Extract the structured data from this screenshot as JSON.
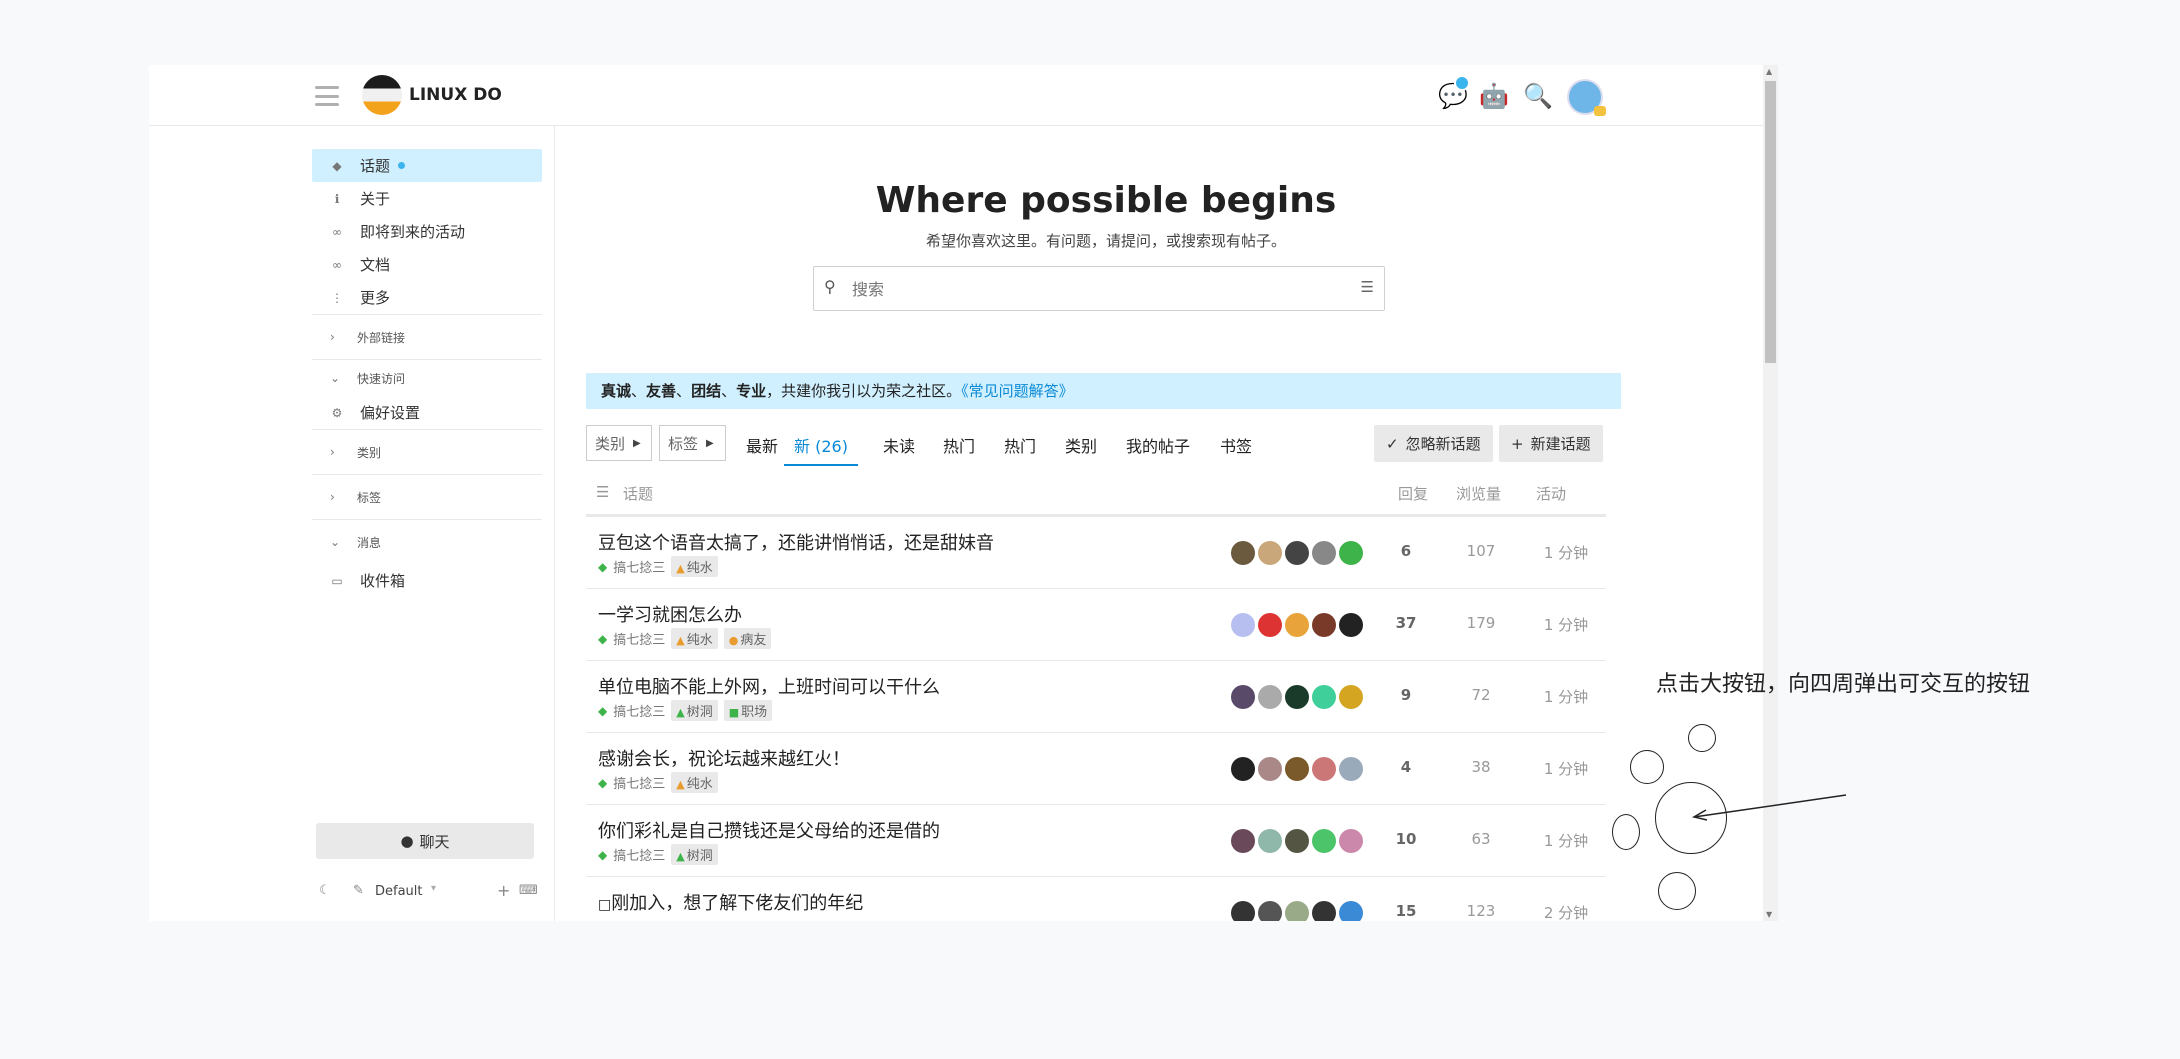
{
  "brand": {
    "name": "LINUX DO"
  },
  "sidebar": {
    "items": [
      {
        "label": "话题",
        "icon": "layers-icon",
        "active": true
      },
      {
        "label": "关于",
        "icon": "info-icon"
      },
      {
        "label": "即将到来的活动",
        "icon": "link-icon"
      },
      {
        "label": "文档",
        "icon": "link-icon"
      },
      {
        "label": "更多",
        "icon": "more-icon"
      }
    ],
    "sections": {
      "external": "外部链接",
      "quick": "快速访问",
      "prefs": "偏好设置",
      "categories": "类别",
      "tags": "标签",
      "messages": "消息",
      "inbox": "收件箱"
    },
    "chat_label": "聊天",
    "theme_label": "Default"
  },
  "hero": {
    "title": "Where possible begins",
    "subtitle": "希望你喜欢这里。有问题，请提问，或搜索现有帖子。",
    "search_placeholder": "搜索"
  },
  "banner": {
    "b1": "真诚",
    "s1": "、",
    "b2": "友善",
    "s2": "、",
    "b3": "团结",
    "s3": "、",
    "b4": "专业",
    "text": "，共建你我引以为荣之社区。",
    "link": "《常见问题解答》"
  },
  "nav": {
    "category_dd": "类别",
    "tag_dd": "标签",
    "tabs": [
      "最新",
      "新 (26)",
      "未读",
      "热门",
      "热门",
      "类别",
      "我的帖子",
      "书签"
    ],
    "dismiss": "忽略新话题",
    "new_topic": "新建话题"
  },
  "table": {
    "headers": {
      "topic": "话题",
      "replies": "回复",
      "views": "浏览量",
      "activity": "活动"
    },
    "rows": [
      {
        "title": "豆包这个语音太搞了，还能讲悄悄话，还是甜妹音",
        "category": "搞七捻三",
        "tags": [
          "纯水"
        ],
        "replies": "6",
        "views": "107",
        "activity": "1 分钟",
        "posters": [
          "#6b5a3e",
          "#c9a77a",
          "#444",
          "#888",
          "#3db34a"
        ]
      },
      {
        "title": "一学习就困怎么办",
        "category": "搞七捻三",
        "tags": [
          "纯水",
          "病友"
        ],
        "replies": "37",
        "views": "179",
        "activity": "1 分钟",
        "posters": [
          "#b7bff0",
          "#d33",
          "#e8a33a",
          "#7a3a2a",
          "#222"
        ]
      },
      {
        "title": "单位电脑不能上外网，上班时间可以干什么",
        "category": "搞七捻三",
        "tags": [
          "树洞",
          "职场"
        ],
        "replies": "9",
        "views": "72",
        "activity": "1 分钟",
        "posters": [
          "#5a4a6a",
          "#aaa",
          "#1a3a2a",
          "#3ecf9a",
          "#d4a520"
        ]
      },
      {
        "title": "感谢会长，祝论坛越来越红火！",
        "category": "搞七捻三",
        "tags": [
          "纯水"
        ],
        "replies": "4",
        "views": "38",
        "activity": "1 分钟",
        "posters": [
          "#222",
          "#a88",
          "#7a5a2a",
          "#c77",
          "#9ab"
        ]
      },
      {
        "title": "你们彩礼是自己攒钱还是父母给的还是借的",
        "category": "搞七捻三",
        "tags": [
          "树洞"
        ],
        "replies": "10",
        "views": "63",
        "activity": "1 分钟",
        "posters": [
          "#6a4a5a",
          "#8fb7aa",
          "#554",
          "#4cc46a",
          "#c8a"
        ]
      },
      {
        "title": "刚加入，想了解下佬友们的年纪",
        "category": "",
        "tags": [],
        "replies": "15",
        "views": "123",
        "activity": "2 分钟",
        "posters": [
          "#333",
          "#555",
          "#9a8",
          "#333",
          "#3a8ad6"
        ]
      }
    ]
  },
  "annotation": {
    "text": "点击大按钮，向四周弹出可交互的按钮"
  },
  "colors": {
    "accent": "#0a8ad6",
    "banner_bg": "#d1f0ff",
    "active_sidebar": "#d1f0ff"
  }
}
